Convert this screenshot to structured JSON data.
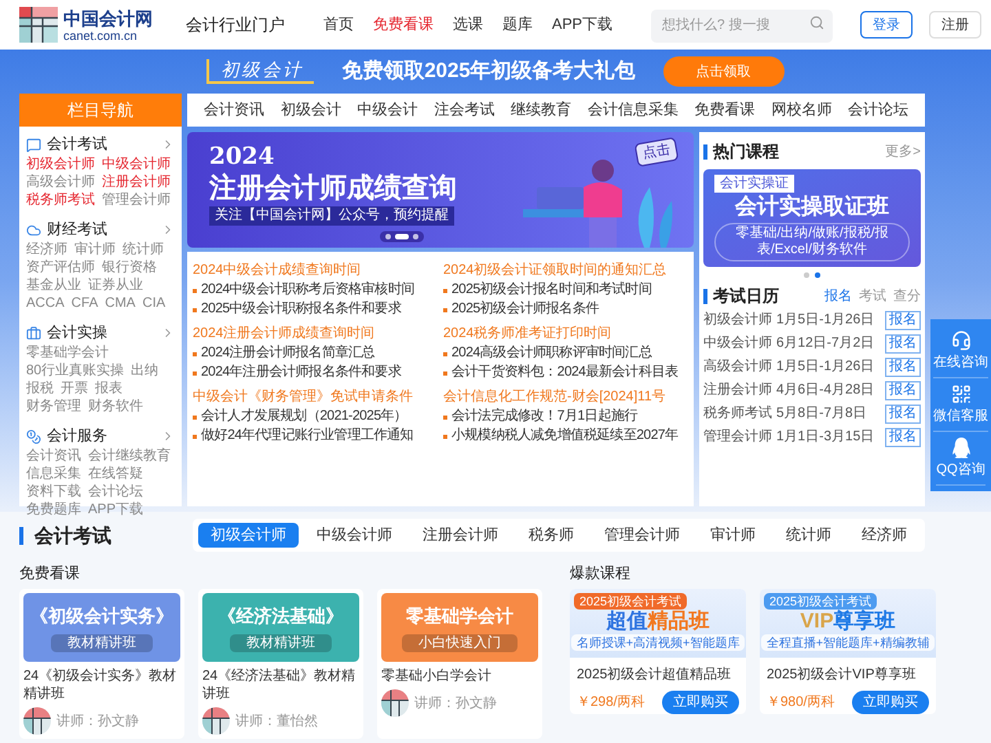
{
  "header": {
    "logo": {
      "name": "中国会计网",
      "domain": "canet.com.cn"
    },
    "tagline": "会计行业门户",
    "nav": [
      {
        "label": "首页",
        "selected": false
      },
      {
        "label": "免费看课",
        "selected": true
      },
      {
        "label": "选课",
        "selected": false
      },
      {
        "label": "题库",
        "selected": false
      },
      {
        "label": "APP下载",
        "selected": false
      }
    ],
    "search": {
      "placeholder": "想找什么? 搜一搜"
    },
    "login": "登录",
    "register": "注册"
  },
  "promo": {
    "tag": "初级会计",
    "headline": "免费领取2025年初级备考大礼包",
    "button": "点击领取"
  },
  "sidebar": {
    "title": "栏目导航",
    "sections": [
      {
        "title": "会计考试",
        "links": [
          {
            "label": "初级会计师",
            "hot": true
          },
          {
            "label": "中级会计师",
            "hot": true
          },
          {
            "label": "高级会计师",
            "hot": false
          },
          {
            "label": "注册会计师",
            "hot": true
          },
          {
            "label": "税务师考试",
            "hot": true
          },
          {
            "label": "管理会计师",
            "hot": false
          }
        ]
      },
      {
        "title": "财经考试",
        "links": [
          {
            "label": "经济师",
            "hot": false
          },
          {
            "label": "审计师",
            "hot": false
          },
          {
            "label": "统计师",
            "hot": false
          },
          {
            "label": "资产评估师",
            "hot": false
          },
          {
            "label": "银行资格",
            "hot": false
          },
          {
            "label": "基金从业",
            "hot": false
          },
          {
            "label": "证券从业",
            "hot": false
          },
          {
            "label": "ACCA",
            "hot": false
          },
          {
            "label": "CFA",
            "hot": false
          },
          {
            "label": "CMA",
            "hot": false
          },
          {
            "label": "CIA",
            "hot": false
          }
        ]
      },
      {
        "title": "会计实操",
        "links": [
          {
            "label": "零基础学会计",
            "hot": false
          },
          {
            "label": "80行业真账实操",
            "hot": false
          },
          {
            "label": "出纳",
            "hot": false
          },
          {
            "label": "报税",
            "hot": false
          },
          {
            "label": "开票",
            "hot": false
          },
          {
            "label": "报表",
            "hot": false
          },
          {
            "label": "财务管理",
            "hot": false
          },
          {
            "label": "财务软件",
            "hot": false
          }
        ]
      },
      {
        "title": "会计服务",
        "links": [
          {
            "label": "会计资讯",
            "hot": false
          },
          {
            "label": "会计继续教育",
            "hot": false
          },
          {
            "label": "信息采集",
            "hot": false
          },
          {
            "label": "在线答疑",
            "hot": false
          },
          {
            "label": "资料下载",
            "hot": false
          },
          {
            "label": "会计论坛",
            "hot": false
          },
          {
            "label": "免费题库",
            "hot": false
          },
          {
            "label": "APP下载",
            "hot": false
          }
        ]
      }
    ]
  },
  "channel_tabs": [
    "会计资讯",
    "初级会计",
    "中级会计",
    "注会考试",
    "继续教育",
    "会计信息采集",
    "免费看课",
    "网校名师",
    "会计论坛"
  ],
  "carousel": {
    "year": "2024",
    "title": "注册会计师成绩查询",
    "subtitle": "关注【中国会计网】公众号，预约提醒",
    "badge": "点击",
    "dots": [
      {
        "selected": false
      },
      {
        "selected": true
      },
      {
        "selected": false
      }
    ]
  },
  "news": [
    {
      "heading": "2024中级会计成绩查询时间",
      "items": [
        "2024中级会计职称考后资格审核时间",
        "2025中级会计职称报名条件和要求"
      ]
    },
    {
      "heading": "2024初级会计证领取时间的通知汇总",
      "items": [
        "2025初级会计报名时间和考试时间",
        "2025初级会计师报名条件"
      ]
    },
    {
      "heading": "2024注册会计师成绩查询时间",
      "items": [
        "2024注册会计师报名简章汇总",
        "2024年注册会计师报名条件和要求"
      ]
    },
    {
      "heading": "2024税务师准考证打印时间",
      "items": [
        "2024高级会计师职称评审时间汇总",
        "会计干货资料包：2024最新会计科目表"
      ]
    },
    {
      "heading": "中级会计《财务管理》免试申请条件",
      "items": [
        "会计人才发展规划（2021-2025年）",
        "做好24年代理记账行业管理工作通知"
      ]
    },
    {
      "heading": "会计信息化工作规范-财会[2024]11号",
      "items": [
        "会计法完成修改！7月1日起施行",
        "小规模纳税人减免增值税延续至2027年"
      ]
    }
  ],
  "hot_courses": {
    "title": "热门课程",
    "more": "更多>",
    "banner": {
      "tag": "会计实操证",
      "title": "会计实操取证班",
      "subtitle": "零基础/出纳/做账/报税/报表/Excel/财务软件"
    },
    "dots": [
      {
        "selected": false
      },
      {
        "selected": true
      }
    ]
  },
  "calendar": {
    "title": "考试日历",
    "tabs": [
      {
        "label": "报名",
        "selected": true
      },
      {
        "label": "考试",
        "selected": false
      },
      {
        "label": "查分",
        "selected": false
      }
    ],
    "rows": [
      {
        "exam": "初级会计师",
        "dates": "1月5日-1月26日",
        "action": "报名"
      },
      {
        "exam": "中级会计师",
        "dates": "6月12日-7月2日",
        "action": "报名"
      },
      {
        "exam": "高级会计师",
        "dates": "1月5日-1月26日",
        "action": "报名"
      },
      {
        "exam": "注册会计师",
        "dates": "4月6日-4月28日",
        "action": "报名"
      },
      {
        "exam": "税务师考试",
        "dates": "5月8日-7月8日",
        "action": "报名"
      },
      {
        "exam": "管理会计师",
        "dates": "1月1日-3月15日",
        "action": "报名"
      }
    ]
  },
  "float_bar": [
    {
      "kind": "headset",
      "label": "在线咨询"
    },
    {
      "kind": "qrcode",
      "label": "微信客服"
    },
    {
      "kind": "qq",
      "label": "QQ咨询"
    }
  ],
  "exam_section": {
    "title": "会计考试",
    "tabs": [
      {
        "label": "初级会计师",
        "selected": true
      },
      {
        "label": "中级会计师",
        "selected": false
      },
      {
        "label": "注册会计师",
        "selected": false
      },
      {
        "label": "税务师",
        "selected": false
      },
      {
        "label": "管理会计师",
        "selected": false
      },
      {
        "label": "审计师",
        "selected": false
      },
      {
        "label": "统计师",
        "selected": false
      },
      {
        "label": "经济师",
        "selected": false
      }
    ]
  },
  "free_courses": {
    "title": "免费看课",
    "cards": [
      {
        "cover_title": "《初级会计实务》",
        "cover_tag": "教材精讲班",
        "color": "#6f93e6",
        "name": "24《初级会计实务》教材精讲班",
        "teacher": "讲师：孙文静"
      },
      {
        "cover_title": "《经济法基础》",
        "cover_tag": "教材精讲班",
        "color": "#3cb2ae",
        "name": "24《经济法基础》教材精讲班",
        "teacher": "讲师：董怡然"
      },
      {
        "cover_title": "零基础学会计",
        "cover_tag": "小白快速入门",
        "color": "#f78a45",
        "name": "零基础小白学会计",
        "teacher": "讲师：孙文静"
      }
    ]
  },
  "hot_sale": {
    "title": "爆款课程",
    "cards": [
      {
        "tag": "2025初级会计考试",
        "words": [
          {
            "text": "超值",
            "color": "#2f74e0"
          },
          {
            "text": "精品班",
            "color": "#f2781f"
          }
        ],
        "strip": "名师授课+高清视频+智能题库",
        "name": "2025初级会计超值精品班",
        "price": "￥298/两科",
        "button": "立即购买"
      },
      {
        "tag": "2025初级会计考试",
        "words": [
          {
            "text": "VIP",
            "color": "#d9a54a"
          },
          {
            "text": "尊享班",
            "color": "#1f7ae6"
          }
        ],
        "strip": "全程直播+智能题库+精编教辅",
        "name": "2025初级会计VIP尊享班",
        "price": "￥980/两科",
        "button": "立即购买"
      }
    ]
  }
}
